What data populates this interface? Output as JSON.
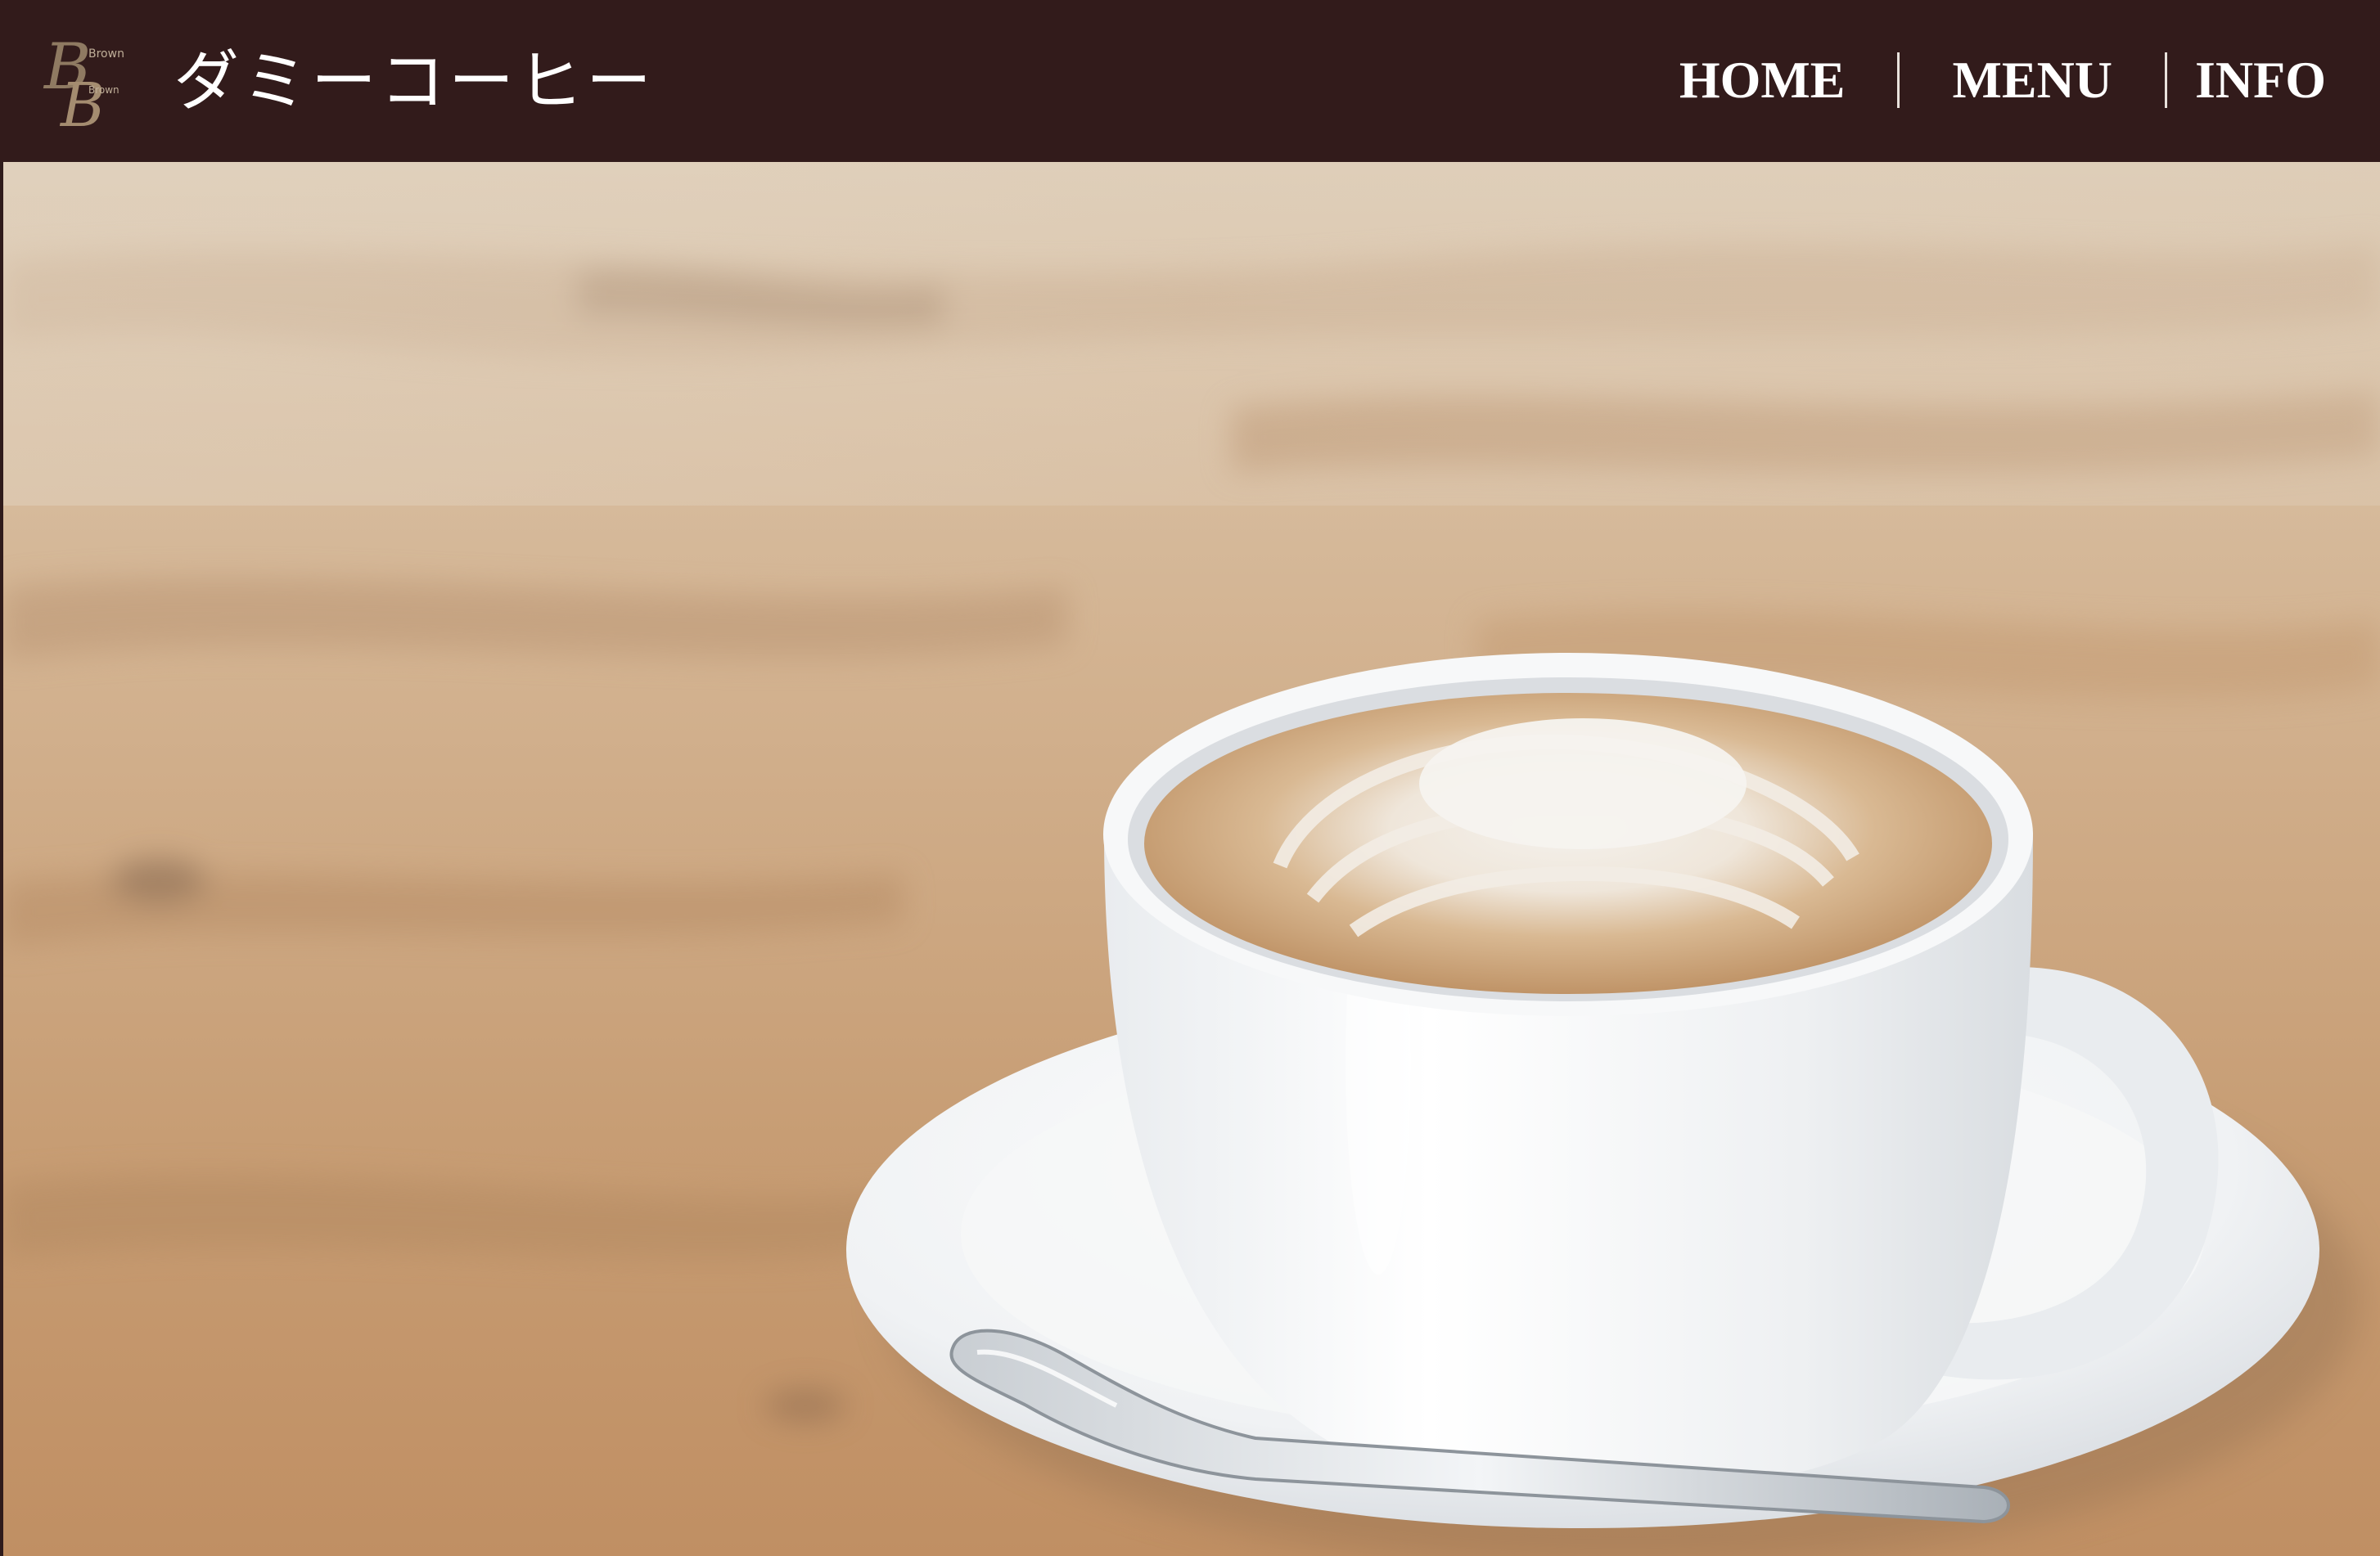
{
  "header": {
    "logo": {
      "monogram": "BB",
      "line1": "Brown",
      "line2": "Brown"
    },
    "brand_name": "ダミーコーヒー"
  },
  "nav": {
    "items": [
      {
        "label": "HOME"
      },
      {
        "label": "MENU"
      },
      {
        "label": "INFO"
      }
    ]
  },
  "hero": {
    "subject": "latte-art-coffee-cup-on-wooden-table"
  },
  "colors": {
    "header_bg": "#321b1b",
    "nav_text": "#ffffff",
    "table_wood": "#c8a27e"
  }
}
